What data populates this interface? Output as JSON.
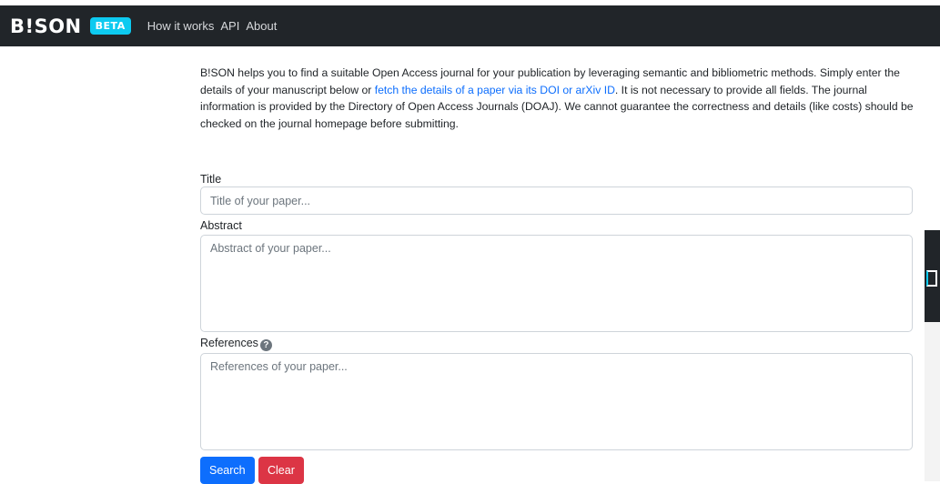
{
  "brand": {
    "logo": "B!SON",
    "badge": "BETA"
  },
  "nav": {
    "items": [
      "How it works",
      "API",
      "About"
    ]
  },
  "intro": {
    "text_before_link": "B!SON helps you to find a suitable Open Access journal for your publication by leveraging semantic and bibliometric methods. Simply enter the details of your manuscript below or ",
    "link_text": "fetch the details of a paper via its DOI or arXiv ID",
    "text_after_link": ". It is not necessary to provide all fields. The journal information is provided by the Directory of Open Access Journals (DOAJ). We cannot guarantee the correctness and details (like costs) should be checked on the journal homepage before submitting."
  },
  "form": {
    "title_label": "Title",
    "title_placeholder": "Title of your paper...",
    "abstract_label": "Abstract",
    "abstract_placeholder": "Abstract of your paper...",
    "references_label": "References",
    "references_help": "?",
    "references_placeholder": "References of your paper...",
    "search_label": "Search",
    "clear_label": "Clear"
  },
  "colors": {
    "navbar": "#212529",
    "beta_badge": "#0dcaf0",
    "link": "#0d6efd",
    "search_button": "#0d6efd",
    "clear_button": "#dc3545"
  }
}
